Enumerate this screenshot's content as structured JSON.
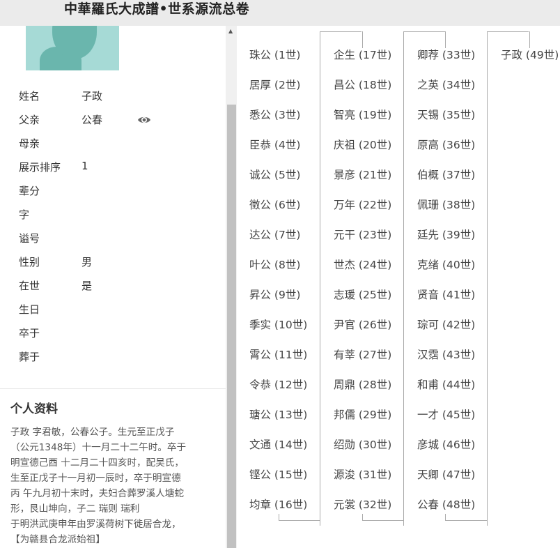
{
  "header": {
    "title": "中華羅氏大成譜•世系源流总卷"
  },
  "profile": {
    "fields": [
      {
        "label": "姓名",
        "value": "子政"
      },
      {
        "label": "父亲",
        "value": "公春"
      },
      {
        "label": "母亲",
        "value": ""
      },
      {
        "label": "展示排序",
        "value": "1"
      },
      {
        "label": "辈分",
        "value": ""
      },
      {
        "label": "字",
        "value": ""
      },
      {
        "label": "谥号",
        "value": ""
      },
      {
        "label": "性别",
        "value": "男"
      },
      {
        "label": "在世",
        "value": "是"
      },
      {
        "label": "生日",
        "value": ""
      },
      {
        "label": "卒于",
        "value": ""
      },
      {
        "label": "葬于",
        "value": ""
      }
    ],
    "icons": {
      "view": "eye-icon",
      "photo": "avatar-silhouette"
    }
  },
  "bio": {
    "title": "个人资料",
    "lines": [
      "子政  字君敏，公春公子。生元至正戊子",
      "（公元1348年）十一月二十二午时。卒于",
      "明宣德己酉 十二月二十四亥时，配吴氏，",
      "生至正戊子十一月初一辰时，卒于明宣德",
      "丙  午九月初十末时，夫妇合葬罗溪人塘蛇",
      "形，艮山坤向，子二  瑞则  瑞利",
      "于明洪武庚申年由罗溪荷树下徙居合龙，",
      "【为赣县合龙派始祖】"
    ]
  },
  "tree": {
    "columns": [
      [
        "珠公 (1世)",
        "居厚 (2世)",
        "悉公 (3世)",
        "臣恭 (4世)",
        "诚公 (5世)",
        "徵公 (6世)",
        "达公 (7世)",
        "叶公 (8世)",
        "昇公 (9世)",
        "季实 (10世)",
        "霄公 (11世)",
        "令恭 (12世)",
        "瑭公 (13世)",
        "文通 (14世)",
        "铿公 (15世)",
        "均章 (16世)"
      ],
      [
        "企生 (17世)",
        "昌公 (18世)",
        "智亮 (19世)",
        "庆祖 (20世)",
        "景彦 (21世)",
        "万年 (22世)",
        "元干 (23世)",
        "世杰 (24世)",
        "志瑗 (25世)",
        "尹官 (26世)",
        "有莘 (27世)",
        "周鼎 (28世)",
        "邦儒 (29世)",
        "绍勋 (30世)",
        "源浚 (31世)",
        "元裳 (32世)"
      ],
      [
        "卿荐 (33世)",
        "之英 (34世)",
        "天锡 (35世)",
        "原高 (36世)",
        "伯概 (37世)",
        "佩珊 (38世)",
        "廷先 (39世)",
        "克绪 (40世)",
        "贤音 (41世)",
        "琮可 (42世)",
        "汉霑 (43世)",
        "和甫 (44世)",
        "一才 (45世)",
        "彦城 (46世)",
        "天卿 (47世)",
        "公春 (48世)"
      ],
      [
        "子政 (49世)"
      ]
    ]
  },
  "colors": {
    "topbar": "#ebebeb",
    "photo_bg": "#a6dad6",
    "scroll_thumb": "#c1c1c1",
    "tree_line": "#aaaaaa"
  }
}
